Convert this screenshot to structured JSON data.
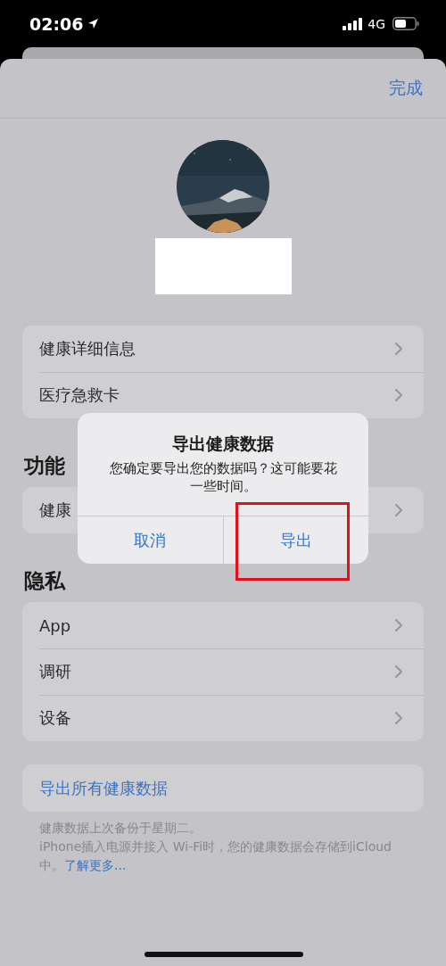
{
  "status_bar": {
    "time": "02:06",
    "network": "4G"
  },
  "nav": {
    "done": "完成"
  },
  "groups": [
    {
      "rows": [
        "健康详细信息",
        "医疗急救卡"
      ]
    },
    {
      "title": "功能",
      "rows": [
        "健康"
      ]
    },
    {
      "title": "隐私",
      "rows": [
        "App",
        "调研",
        "设备"
      ]
    }
  ],
  "export_link": "导出所有健康数据",
  "footer": {
    "backup_note": "健康数据上次备份于星期二。",
    "storage_note": "iPhone插入电源并接入 Wi-Fi时，您的健康数据会存储到iCloud中。",
    "link": "了解更多..."
  },
  "dialog": {
    "title": "导出健康数据",
    "message": "您确定要导出您的数据吗？这可能要花一些时间。",
    "buttons": [
      {
        "label": "取消",
        "highlighted": false
      },
      {
        "label": "导出",
        "highlighted": true
      }
    ]
  }
}
